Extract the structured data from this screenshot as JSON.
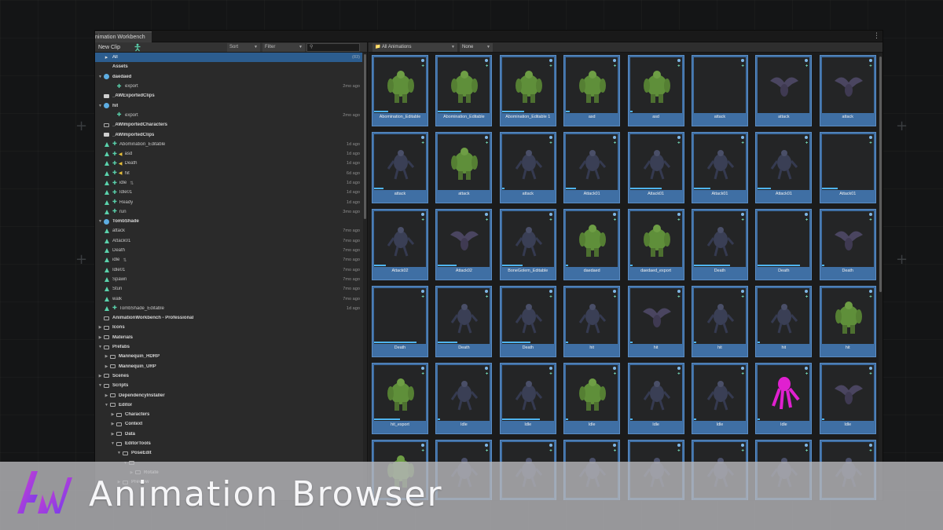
{
  "window": {
    "tab_title": "nimation Workbench",
    "menu_icon": "kebab-menu-icon"
  },
  "toolbar": {
    "new_clip": "New Clip",
    "sort": "Sort",
    "filter": "Filter",
    "search_placeholder": ""
  },
  "tree": [
    {
      "label": "All",
      "count": "(83)",
      "selected": true,
      "icon": "scene-icon",
      "indent": 0
    },
    {
      "label": "Assets",
      "bold": true,
      "icon": "none",
      "indent": 0
    },
    {
      "label": "daedaed",
      "bold": true,
      "icon": "prefab",
      "fold": "down",
      "indent": 0
    },
    {
      "label": "export",
      "icon": "man",
      "indent": 2,
      "ago": "2mo ago"
    },
    {
      "label": "_AWExportedClips",
      "bold": true,
      "icon": "folder-fill",
      "indent": 0
    },
    {
      "label": "hit",
      "bold": true,
      "icon": "prefab",
      "fold": "down",
      "indent": 0
    },
    {
      "label": "export",
      "icon": "man",
      "indent": 2,
      "ago": "2mo ago"
    },
    {
      "label": "_AWImportedCharacters",
      "bold": true,
      "icon": "folder",
      "indent": 0
    },
    {
      "label": "_AWImportedClips",
      "bold": true,
      "icon": "folder-fill",
      "indent": 0
    },
    {
      "label": "Abomination_Editable",
      "icon": "tri-man",
      "indent": 0,
      "ago": "1d ago"
    },
    {
      "label": "asd",
      "icon": "tri-man-audio",
      "indent": 0,
      "ago": "1d ago"
    },
    {
      "label": "Death",
      "icon": "tri-man-audio",
      "indent": 0,
      "ago": "1d ago"
    },
    {
      "label": "hit",
      "icon": "tri-man-audio",
      "indent": 0,
      "ago": "6d ago"
    },
    {
      "label": "idle",
      "icon": "tri-man",
      "indent": 0,
      "ago": "1d ago",
      "loop": true
    },
    {
      "label": "Idle01",
      "icon": "tri-man",
      "indent": 0,
      "ago": "1d ago"
    },
    {
      "label": "Ready",
      "icon": "tri-man",
      "indent": 0,
      "ago": "1d ago"
    },
    {
      "label": "run",
      "icon": "tri-man",
      "indent": 0,
      "ago": "3mo ago"
    },
    {
      "label": "TombShade",
      "bold": true,
      "icon": "prefab",
      "fold": "down",
      "indent": 0
    },
    {
      "label": "attack",
      "icon": "tri",
      "indent": 0,
      "ago": "7mo ago"
    },
    {
      "label": "Attack01",
      "icon": "tri",
      "indent": 0,
      "ago": "7mo ago"
    },
    {
      "label": "Death",
      "icon": "tri",
      "indent": 0,
      "ago": "7mo ago"
    },
    {
      "label": "idle",
      "icon": "tri",
      "indent": 0,
      "ago": "7mo ago",
      "loop": true
    },
    {
      "label": "Idle01",
      "icon": "tri",
      "indent": 0,
      "ago": "7mo ago"
    },
    {
      "label": "Spawn",
      "icon": "tri",
      "indent": 0,
      "ago": "7mo ago"
    },
    {
      "label": "Stun",
      "icon": "tri",
      "indent": 0,
      "ago": "7mo ago"
    },
    {
      "label": "walk",
      "icon": "tri",
      "indent": 0,
      "ago": "7mo ago"
    },
    {
      "label": "TombShade_Editable",
      "icon": "tri-man",
      "indent": 0,
      "ago": "1d ago"
    },
    {
      "label": "AnimationWorkbench - Professional",
      "bold": true,
      "icon": "folder",
      "indent": 0
    },
    {
      "label": "Icons",
      "bold": true,
      "icon": "folder",
      "fold": "right",
      "indent": 0
    },
    {
      "label": "Materials",
      "bold": true,
      "icon": "folder",
      "fold": "right",
      "indent": 0
    },
    {
      "label": "Prefabs",
      "bold": true,
      "icon": "folder",
      "fold": "down",
      "indent": 0
    },
    {
      "label": "Mannequin_HDRP",
      "bold": true,
      "icon": "folder",
      "fold": "right",
      "indent": 1
    },
    {
      "label": "Mannequin_URP",
      "bold": true,
      "icon": "folder",
      "fold": "right",
      "indent": 1
    },
    {
      "label": "Scenes",
      "bold": true,
      "icon": "folder",
      "fold": "right",
      "indent": 0
    },
    {
      "label": "Scripts",
      "bold": true,
      "icon": "folder",
      "fold": "down",
      "indent": 0
    },
    {
      "label": "DependencyInstaller",
      "bold": true,
      "icon": "folder",
      "fold": "right",
      "indent": 1
    },
    {
      "label": "Editor",
      "bold": true,
      "icon": "folder",
      "fold": "down",
      "indent": 1
    },
    {
      "label": "Characters",
      "bold": true,
      "icon": "folder",
      "fold": "right",
      "indent": 2
    },
    {
      "label": "Context",
      "bold": true,
      "icon": "folder",
      "fold": "right",
      "indent": 2
    },
    {
      "label": "Data",
      "bold": true,
      "icon": "folder",
      "fold": "right",
      "indent": 2
    },
    {
      "label": "EditorTools",
      "bold": true,
      "icon": "folder",
      "fold": "down",
      "indent": 2
    },
    {
      "label": "PoseEdit",
      "bold": true,
      "icon": "folder",
      "fold": "down",
      "indent": 3
    },
    {
      "label": "",
      "bold": true,
      "icon": "folder",
      "fold": "down",
      "indent": 4
    },
    {
      "label": "Rotate",
      "bold": true,
      "icon": "folder",
      "fold": "right",
      "indent": 5
    },
    {
      "label": "Preview",
      "bold": true,
      "icon": "folder",
      "fold": "right",
      "indent": 3
    }
  ],
  "grid_toolbar": {
    "collection": "All Animations",
    "rig_filter": "None"
  },
  "colors": {
    "green": "#5f8f3a",
    "dark": "#3a3f55",
    "bat": "#4a4560",
    "magenta": "#e020d0"
  },
  "cards": [
    {
      "label": "Abomination_Editable",
      "fig": "green",
      "prog": 0.28
    },
    {
      "label": "Abomination_Editable",
      "fig": "green",
      "prog": 0.45
    },
    {
      "label": "Abomination_Editable 1",
      "fig": "green",
      "prog": 0.42
    },
    {
      "label": "asd",
      "fig": "green",
      "prog": 0.08
    },
    {
      "label": "asd",
      "fig": "green",
      "prog": 0.05
    },
    {
      "label": "attack",
      "fig": "none",
      "prog": 0.0
    },
    {
      "label": "attack",
      "fig": "bat",
      "prog": 0.0
    },
    {
      "label": "attack",
      "fig": "bat",
      "prog": 0.0
    },
    {
      "label": "attack",
      "fig": "dark",
      "prog": 0.18
    },
    {
      "label": "attack",
      "fig": "green",
      "prog": 0.0
    },
    {
      "label": "attack",
      "fig": "dark",
      "prog": 0.05
    },
    {
      "label": "Attack01",
      "fig": "dark",
      "prog": 0.2
    },
    {
      "label": "Attack01",
      "fig": "dark",
      "prog": 0.6
    },
    {
      "label": "Attack01",
      "fig": "dark",
      "prog": 0.32
    },
    {
      "label": "Attack01",
      "fig": "dark",
      "prog": 0.25
    },
    {
      "label": "Attack01",
      "fig": "none",
      "prog": 0.3
    },
    {
      "label": "Attack02",
      "fig": "dark",
      "prog": 0.22
    },
    {
      "label": "Attack02",
      "fig": "bat",
      "prog": 0.36
    },
    {
      "label": "BoneGolem_Editable",
      "fig": "dark",
      "prog": 0.4
    },
    {
      "label": "daedaed",
      "fig": "green",
      "prog": 0.05
    },
    {
      "label": "daedaed_export",
      "fig": "green",
      "prog": 0.04
    },
    {
      "label": "Death",
      "fig": "dark",
      "prog": 0.7
    },
    {
      "label": "Death",
      "fig": "none",
      "prog": 0.82
    },
    {
      "label": "Death",
      "fig": "bat",
      "prog": 0.05
    },
    {
      "label": "Death",
      "fig": "none",
      "prog": 0.82
    },
    {
      "label": "Death",
      "fig": "dark",
      "prog": 0.38
    },
    {
      "label": "Death",
      "fig": "dark",
      "prog": 0.55
    },
    {
      "label": "hit",
      "fig": "dark",
      "prog": 0.04
    },
    {
      "label": "hit",
      "fig": "bat",
      "prog": 0.04
    },
    {
      "label": "hit",
      "fig": "dark",
      "prog": 0.04
    },
    {
      "label": "hit",
      "fig": "dark",
      "prog": 0.04
    },
    {
      "label": "hit",
      "fig": "green",
      "prog": 0.0
    },
    {
      "label": "hit_export",
      "fig": "green",
      "prog": 0.5
    },
    {
      "label": "Idle",
      "fig": "dark",
      "prog": 0.04
    },
    {
      "label": "Idle",
      "fig": "dark",
      "prog": 0.72
    },
    {
      "label": "Idle",
      "fig": "green",
      "prog": 0.05
    },
    {
      "label": "Idle",
      "fig": "dark",
      "prog": 0.04
    },
    {
      "label": "Idle",
      "fig": "dark",
      "prog": 0.04
    },
    {
      "label": "Idle",
      "fig": "magenta",
      "prog": 0.04
    },
    {
      "label": "Idle",
      "fig": "bat",
      "prog": 0.04
    },
    {
      "label": "",
      "fig": "green",
      "prog": 0.0
    },
    {
      "label": "",
      "fig": "dark",
      "prog": 0.0
    },
    {
      "label": "",
      "fig": "dark",
      "prog": 0.0
    },
    {
      "label": "",
      "fig": "dark",
      "prog": 0.0
    },
    {
      "label": "",
      "fig": "dark",
      "prog": 0.0
    },
    {
      "label": "",
      "fig": "dark",
      "prog": 0.0
    },
    {
      "label": "",
      "fig": "dark",
      "prog": 0.0
    },
    {
      "label": "",
      "fig": "dark",
      "prog": 0.0
    }
  ],
  "banner": {
    "title": "Animation Browser",
    "logo_icon": "aw-logo-icon"
  }
}
